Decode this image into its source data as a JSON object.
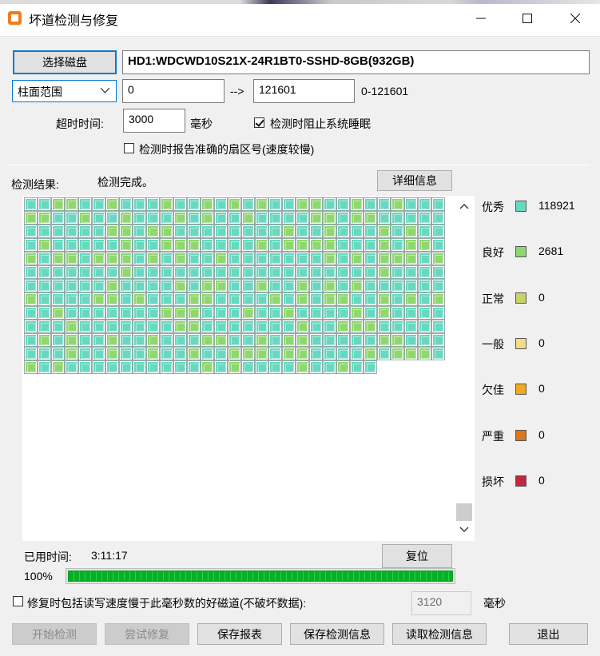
{
  "window": {
    "title": "坏道检测与修复",
    "minimize": "—",
    "maximize": "☐",
    "close": "✕"
  },
  "controls": {
    "select_disk_button": "选择磁盘",
    "disk_name": "HD1:WDCWD10S21X-24R1BT0-SSHD-8GB(932GB)",
    "range_mode": "柱面范围",
    "range_start": "0",
    "arrow": "-->",
    "range_end": "121601",
    "range_hint": "0-121601",
    "timeout_label": "超时时间:",
    "timeout_value": "3000",
    "timeout_unit": "毫秒",
    "prevent_sleep_label": "检测时阻止系统睡眠",
    "prevent_sleep_checked": true,
    "report_sector_label": "检测时报告准确的扇区号(速度较慢)",
    "report_sector_checked": false
  },
  "results": {
    "label": "检测结果:",
    "status": "检测完成。",
    "details_button": "详细信息"
  },
  "grid": {
    "columns": 31,
    "total_cells": 398,
    "colors": {
      "excellent": "#67d9c0",
      "good": "#8fd86f"
    }
  },
  "legend": [
    {
      "label": "优秀",
      "color": "#67d9c0",
      "count": "118921"
    },
    {
      "label": "良好",
      "color": "#8fd86f",
      "count": "2681"
    },
    {
      "label": "正常",
      "color": "#c6d36b",
      "count": "0"
    },
    {
      "label": "一般",
      "color": "#f2dc8a",
      "count": "0"
    },
    {
      "label": "欠佳",
      "color": "#f3a91f",
      "count": "0"
    },
    {
      "label": "严重",
      "color": "#d9781a",
      "count": "0"
    },
    {
      "label": "损坏",
      "color": "#c3263e",
      "count": "0"
    }
  ],
  "progress": {
    "elapsed_label": "已用时间:",
    "elapsed_value": "3:11:17",
    "reset_button": "复位",
    "percent_text": "100%",
    "fraction": 1.0
  },
  "repair": {
    "include_slow_label": "修复时包括读写速度慢于此毫秒数的好磁道(不破坏数据):",
    "include_slow_checked": false,
    "threshold_value": "3120",
    "threshold_unit": "毫秒"
  },
  "footer": {
    "start_button": "开始检测",
    "try_repair_button": "尝试修复",
    "save_report_button": "保存报表",
    "save_info_button": "保存检测信息",
    "load_info_button": "读取检测信息",
    "exit_button": "退出"
  }
}
